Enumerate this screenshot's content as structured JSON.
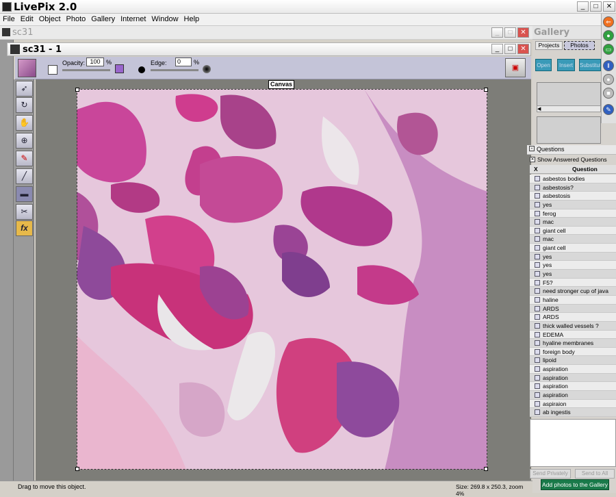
{
  "app": {
    "title": "LivePix 2.0"
  },
  "menu": [
    "File",
    "Edit",
    "Object",
    "Photo",
    "Gallery",
    "Internet",
    "Window",
    "Help"
  ],
  "document": {
    "outer_title": "sc31",
    "inner_title": "sc31 - 1"
  },
  "toolbar": {
    "opacity_label": "Opacity:",
    "opacity_value": "100",
    "opacity_unit": "%",
    "edge_label": "Edge:",
    "edge_value": "0",
    "edge_unit": "%"
  },
  "canvas": {
    "label": "Canvas"
  },
  "status": {
    "left": "Drag to move this object.",
    "right": "Size: 269.8 x 250.3, zoom 4%"
  },
  "gallery": {
    "title": "Gallery",
    "tabs": [
      "Projects",
      "Photos"
    ],
    "buttons": [
      "Open",
      "Insert",
      "Substitute"
    ]
  },
  "questions": {
    "title": "Questions",
    "show_answered": "Show Answered Questions",
    "col_x": "X",
    "col_question": "Question",
    "items": [
      "asbestos bodies",
      "asbestosis?",
      "asbestosis",
      "yes",
      "ferog",
      "mac",
      "giant cell",
      "mac",
      "giant cell",
      "yes",
      "yes",
      "yes",
      "F5?",
      "need stronger cup of java",
      "haline",
      "ARDS",
      "ARDS",
      "thick walled vessels ?",
      "EDEMA",
      "hyaline membranes",
      "foreign body",
      "lipoid",
      "aspiration",
      "aspiration",
      "aspiration",
      "aspiration",
      "aspiraion",
      "ab ingestis"
    ],
    "send_privately": "Send Privately",
    "send_to_all": "Send to All"
  },
  "footer_button": "Add photos to the Gallery"
}
